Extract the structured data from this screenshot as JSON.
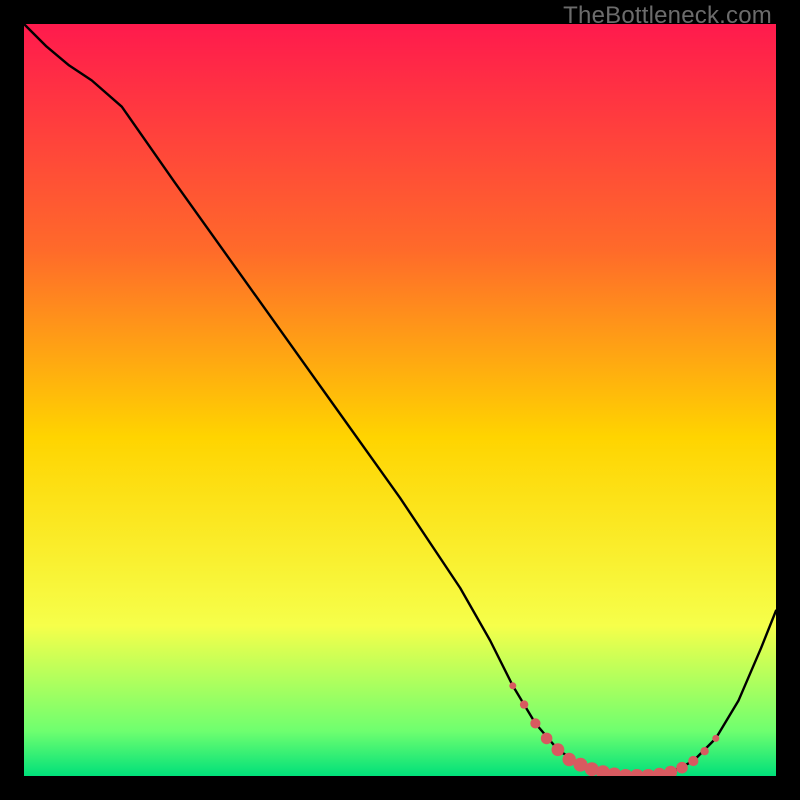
{
  "watermark": "TheBottleneck.com",
  "colors": {
    "grad_top": "#ff1a4d",
    "grad_mid1": "#ff6a2a",
    "grad_mid2": "#ffd400",
    "grad_low1": "#f6ff4a",
    "grad_low2": "#6fff6f",
    "grad_bottom": "#00e07a",
    "line": "#000000",
    "marker": "#d85a60"
  },
  "chart_data": {
    "type": "line",
    "title": "",
    "xlabel": "",
    "ylabel": "",
    "xlim": [
      0,
      100
    ],
    "ylim": [
      0,
      100
    ],
    "curve": [
      {
        "x": 0,
        "y": 100
      },
      {
        "x": 3,
        "y": 97
      },
      {
        "x": 6,
        "y": 94.5
      },
      {
        "x": 9,
        "y": 92.5
      },
      {
        "x": 13,
        "y": 89
      },
      {
        "x": 20,
        "y": 79
      },
      {
        "x": 30,
        "y": 65
      },
      {
        "x": 40,
        "y": 51
      },
      {
        "x": 50,
        "y": 37
      },
      {
        "x": 58,
        "y": 25
      },
      {
        "x": 62,
        "y": 18
      },
      {
        "x": 65,
        "y": 12
      },
      {
        "x": 68,
        "y": 7
      },
      {
        "x": 71,
        "y": 3.5
      },
      {
        "x": 74,
        "y": 1.5
      },
      {
        "x": 77,
        "y": 0.5
      },
      {
        "x": 80,
        "y": 0
      },
      {
        "x": 83,
        "y": 0
      },
      {
        "x": 86,
        "y": 0.5
      },
      {
        "x": 89,
        "y": 2
      },
      {
        "x": 92,
        "y": 5
      },
      {
        "x": 95,
        "y": 10
      },
      {
        "x": 98,
        "y": 17
      },
      {
        "x": 100,
        "y": 22
      }
    ],
    "markers": [
      {
        "x": 65,
        "y": 12,
        "r": 2.2
      },
      {
        "x": 66.5,
        "y": 9.5,
        "r": 2.6
      },
      {
        "x": 68,
        "y": 7,
        "r": 3.2
      },
      {
        "x": 69.5,
        "y": 5,
        "r": 3.6
      },
      {
        "x": 71,
        "y": 3.5,
        "r": 4.0
      },
      {
        "x": 72.5,
        "y": 2.2,
        "r": 4.2
      },
      {
        "x": 74,
        "y": 1.5,
        "r": 4.4
      },
      {
        "x": 75.5,
        "y": 0.9,
        "r": 4.4
      },
      {
        "x": 77,
        "y": 0.5,
        "r": 4.4
      },
      {
        "x": 78.5,
        "y": 0.2,
        "r": 4.4
      },
      {
        "x": 80,
        "y": 0,
        "r": 4.4
      },
      {
        "x": 81.5,
        "y": 0,
        "r": 4.4
      },
      {
        "x": 83,
        "y": 0,
        "r": 4.4
      },
      {
        "x": 84.5,
        "y": 0.2,
        "r": 4.2
      },
      {
        "x": 86,
        "y": 0.5,
        "r": 4.0
      },
      {
        "x": 87.5,
        "y": 1.1,
        "r": 3.6
      },
      {
        "x": 89,
        "y": 2,
        "r": 3.2
      },
      {
        "x": 90.5,
        "y": 3.3,
        "r": 2.6
      },
      {
        "x": 92,
        "y": 5,
        "r": 2.2
      }
    ]
  }
}
